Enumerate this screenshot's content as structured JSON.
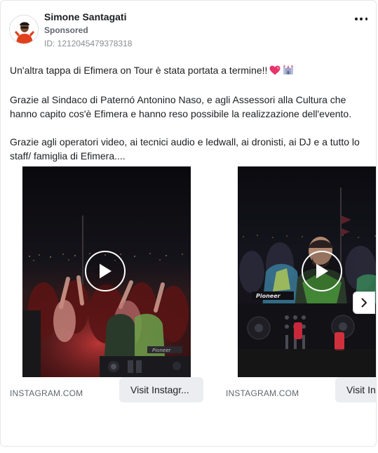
{
  "advertiser": {
    "name": "Simone Santagati",
    "sponsored_label": "Sponsored",
    "ad_id": "ID: 1212045479378318"
  },
  "post": {
    "paragraphs": [
      "Un'altra tappa di Efimera on Tour è stata portata a termine!!",
      "Grazie al Sindaco di Paternó Antonino Naso, e agli Assessori alla Cultura che hanno capito cos'è Efimera e hanno reso possibile la realizzazione dell'evento.",
      "Grazie agli operatori video, ai tecnici audio e ledwall, ai dronisti, ai DJ e a tutto lo staff/ famiglia di Efimera...."
    ],
    "emojis": [
      "heart-emoji",
      "castle-emoji"
    ]
  },
  "carousel": {
    "cards": [
      {
        "domain": "INSTAGRAM.COM",
        "cta": "Visit Instagr...",
        "media": "video-thumbnail-crowd"
      },
      {
        "domain": "INSTAGRAM.COM",
        "cta": "Visit Ins",
        "media": "video-thumbnail-dj"
      }
    ],
    "next_icon": "chevron-right-icon"
  },
  "icons": {
    "more": "more-options-icon",
    "play": "play-icon"
  },
  "colors": {
    "text_primary": "#1c1e21",
    "text_secondary": "#606770",
    "button_bg": "#ebedf0",
    "border": "#e4e6eb"
  }
}
